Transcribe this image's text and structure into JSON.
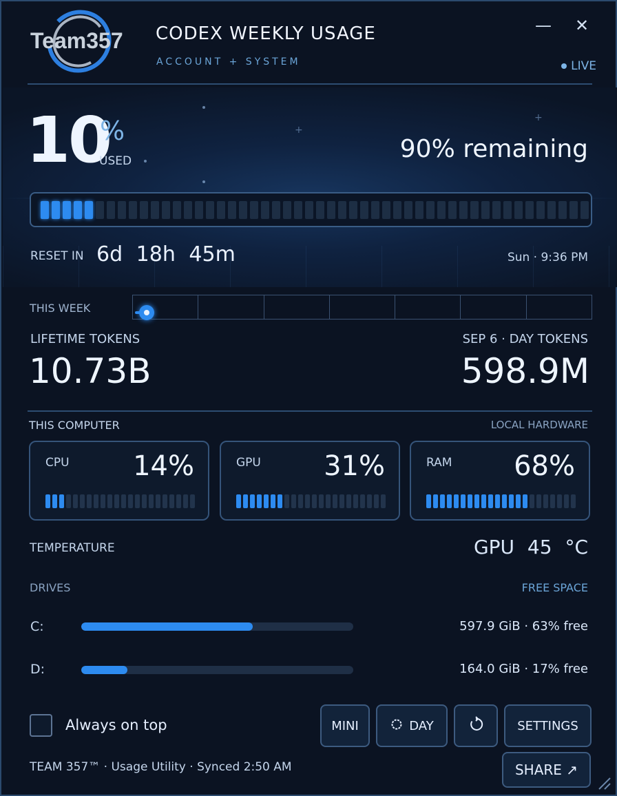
{
  "header": {
    "logo_text": "Team357",
    "title": "CODEX WEEKLY USAGE",
    "subtitle": "ACCOUNT + SYSTEM",
    "live_label": "LIVE",
    "minimize_icon": "minimize-icon",
    "close_icon": "close-icon"
  },
  "usage": {
    "used_value": "10",
    "used_symbol": "%",
    "used_label": "USED",
    "remaining_text": "90% remaining",
    "progress_fraction": 0.1,
    "total_segments": 50,
    "lit_segments": 5
  },
  "reset": {
    "label": "RESET IN",
    "value": "6d 18h 45m",
    "at": "Sun · 9:36 PM"
  },
  "week": {
    "label": "THIS WEEK",
    "days": 7,
    "position_fraction": 0.02
  },
  "tokens": {
    "lifetime_label": "LIFETIME TOKENS",
    "lifetime_value": "10.73B",
    "day_label": "SEP 6 · DAY TOKENS",
    "day_value": "598.9M"
  },
  "computer": {
    "label": "THIS COMPUTER",
    "right_label": "LOCAL HARDWARE",
    "cards": [
      {
        "name": "CPU",
        "value": "14%",
        "level": 0.14
      },
      {
        "name": "GPU",
        "value": "31%",
        "level": 0.31
      },
      {
        "name": "RAM",
        "value": "68%",
        "level": 0.68
      }
    ]
  },
  "temperature": {
    "label": "TEMPERATURE",
    "value": "GPU 45 °C"
  },
  "drives": {
    "label": "DRIVES",
    "right_label": "FREE SPACE",
    "items": [
      {
        "letter": "C:",
        "info": "597.9 GiB · 63% free",
        "used_fraction": 0.63
      },
      {
        "letter": "D:",
        "info": "164.0 GiB · 17% free",
        "used_fraction": 0.17
      }
    ]
  },
  "footer": {
    "always_on_top_label": "Always on top",
    "always_on_top_checked": false,
    "mini_label": "MINI",
    "day_label": "DAY",
    "day_icon": "sun-icon",
    "refresh_icon": "refresh-icon",
    "settings_label": "SETTINGS",
    "share_label": "SHARE ↗",
    "status_text": "TEAM 357™ · Usage Utility · Synced 2:50 AM"
  },
  "colors": {
    "accent": "#2d8bf0",
    "background": "#0b1322",
    "border": "#2b4a6e"
  }
}
